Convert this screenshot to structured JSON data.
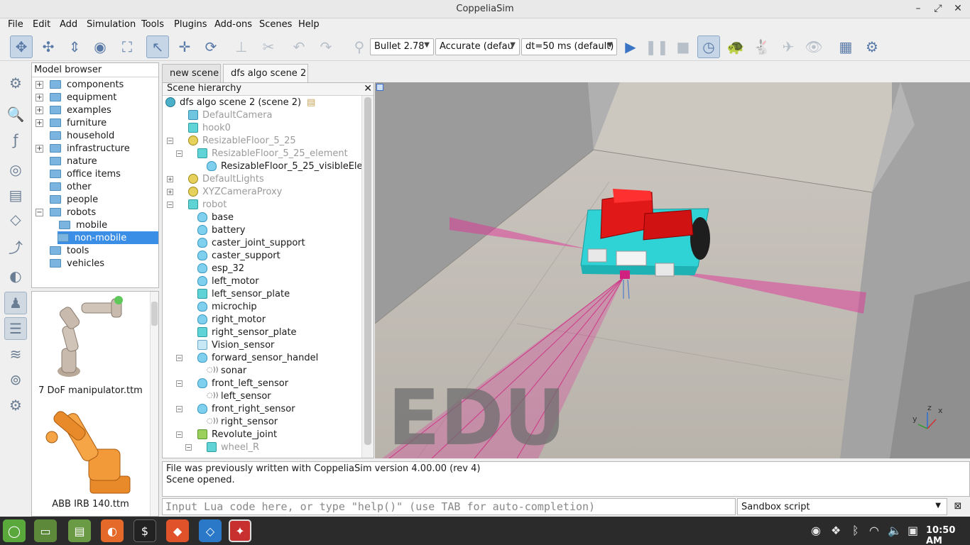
{
  "window": {
    "title": "CoppeliaSim"
  },
  "menu": [
    "File",
    "Edit",
    "Add",
    "Simulation",
    "Tools",
    "Plugins",
    "Add-ons",
    "Scenes",
    "Help"
  ],
  "toolbar": {
    "physics_engine": "Bullet 2.78",
    "accuracy": "Accurate (defau",
    "timestep": "dt=50 ms (default)"
  },
  "model_browser": {
    "title": "Model browser",
    "items": [
      {
        "label": "components",
        "expandable": true
      },
      {
        "label": "equipment",
        "expandable": true
      },
      {
        "label": "examples",
        "expandable": true
      },
      {
        "label": "furniture",
        "expandable": true
      },
      {
        "label": "household",
        "expandable": false
      },
      {
        "label": "infrastructure",
        "expandable": true
      },
      {
        "label": "nature",
        "expandable": false
      },
      {
        "label": "office items",
        "expandable": false
      },
      {
        "label": "other",
        "expandable": false
      },
      {
        "label": "people",
        "expandable": false
      },
      {
        "label": "robots",
        "expandable": true,
        "expanded": true
      },
      {
        "label": "mobile",
        "child": true
      },
      {
        "label": "non-mobile",
        "child": true,
        "selected": true
      },
      {
        "label": "tools",
        "expandable": false
      },
      {
        "label": "vehicles",
        "expandable": false
      }
    ],
    "thumbnails": [
      {
        "label": "7 DoF manipulator.ttm"
      },
      {
        "label": "ABB IRB 140.ttm"
      }
    ]
  },
  "tabs": [
    {
      "label": "new scene",
      "active": false
    },
    {
      "label": "dfs algo scene 2",
      "active": true
    }
  ],
  "hierarchy": {
    "title": "Scene hierarchy",
    "root": "dfs algo scene 2 (scene 2)",
    "items": [
      {
        "label": "DefaultCamera",
        "icon": "camera",
        "grey": true
      },
      {
        "label": "hook0",
        "icon": "cube",
        "grey": true
      },
      {
        "label": "ResizableFloor_5_25",
        "icon": "light",
        "grey": true
      },
      {
        "label": "ResizableFloor_5_25_element",
        "icon": "cube",
        "grey": true
      },
      {
        "label": "ResizableFloor_5_25_visibleEle",
        "icon": "shape",
        "grey": false
      },
      {
        "label": "DefaultLights",
        "icon": "light",
        "grey": true
      },
      {
        "label": "XYZCameraProxy",
        "icon": "light",
        "grey": true
      },
      {
        "label": "robot",
        "icon": "cube",
        "grey": true
      },
      {
        "label": "base",
        "icon": "shape"
      },
      {
        "label": "battery",
        "icon": "shape"
      },
      {
        "label": "caster_joint_support",
        "icon": "shape"
      },
      {
        "label": "caster_support",
        "icon": "shape"
      },
      {
        "label": "esp_32",
        "icon": "shape"
      },
      {
        "label": "left_motor",
        "icon": "shape"
      },
      {
        "label": "left_sensor_plate",
        "icon": "cube"
      },
      {
        "label": "microchip",
        "icon": "shape"
      },
      {
        "label": "right_motor",
        "icon": "shape"
      },
      {
        "label": "right_sensor_plate",
        "icon": "cube"
      },
      {
        "label": "Vision_sensor",
        "icon": "sensor"
      },
      {
        "label": "forward_sensor_handel",
        "icon": "shape"
      },
      {
        "label": "sonar",
        "icon": "sonar"
      },
      {
        "label": "front_left_sensor",
        "icon": "shape"
      },
      {
        "label": "left_sensor",
        "icon": "sonar"
      },
      {
        "label": "front_right_sensor",
        "icon": "shape"
      },
      {
        "label": "right_sensor",
        "icon": "sonar"
      },
      {
        "label": "Revolute_joint",
        "icon": "joint"
      },
      {
        "label": "wheel_R",
        "icon": "cube",
        "grey": true
      }
    ]
  },
  "viewport": {
    "watermark": "EDU",
    "axes": {
      "x": "x",
      "y": "y",
      "z": "z"
    }
  },
  "console": {
    "lines": [
      "File was previously written with CoppeliaSim version 4.00.00 (rev 4)",
      "Scene opened."
    ],
    "input_placeholder": "Input Lua code here, or type \"help()\" (use TAB for auto-completion)",
    "script_selector": "Sandbox script"
  },
  "taskbar": {
    "clock": "10:50 AM"
  }
}
